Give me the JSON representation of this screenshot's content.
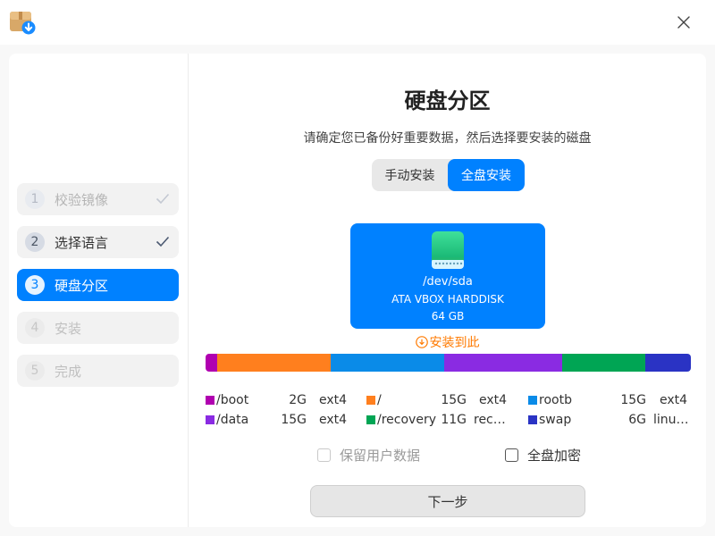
{
  "window": {
    "icons": {
      "app": "installer-icon",
      "close": "close-icon"
    }
  },
  "sidebar": {
    "steps": [
      {
        "num": "1",
        "label": "校验镜像",
        "state": "done-faint"
      },
      {
        "num": "2",
        "label": "选择语言",
        "state": "done"
      },
      {
        "num": "3",
        "label": "硬盘分区",
        "state": "active"
      },
      {
        "num": "4",
        "label": "安装",
        "state": "todo"
      },
      {
        "num": "5",
        "label": "完成",
        "state": "todo"
      }
    ]
  },
  "main": {
    "title": "硬盘分区",
    "subtitle": "请确定您已备份好重要数据，然后选择要安装的磁盘",
    "mode_tabs": [
      {
        "label": "手动安装",
        "selected": false
      },
      {
        "label": "全盘安装",
        "selected": true
      }
    ],
    "disk": {
      "path": "/dev/sda",
      "model": "ATA VBOX HARDDISK",
      "size": "64 GB",
      "icon": "hard-disk-icon"
    },
    "install_here": "安装到此",
    "partitions": [
      {
        "name": "/boot",
        "size": "2G",
        "fs": "ext4",
        "color": "#b000b0"
      },
      {
        "name": "/",
        "size": "15G",
        "fs": "ext4",
        "color": "#ff7f1e"
      },
      {
        "name": "rootb",
        "size": "15G",
        "fs": "ext4",
        "color": "#0a8be8"
      },
      {
        "name": "/data",
        "size": "15G",
        "fs": "ext4",
        "color": "#8a2be2"
      },
      {
        "name": "/recovery",
        "size": "11G",
        "fs": "rec…",
        "color": "#00a554"
      },
      {
        "name": "swap",
        "size": "6G",
        "fs": "linu…",
        "color": "#2a33c4"
      }
    ],
    "bar_colors": {
      "boot": "#b000b0",
      "root": "#ff7f1e",
      "rootb": "#0a8be8",
      "data": "#8a2be2",
      "recovery": "#00a554",
      "swap": "#2a33c4"
    },
    "keep_user_data": "保留用户数据",
    "full_disk_encryption": "全盘加密",
    "next_button": "下一步"
  }
}
